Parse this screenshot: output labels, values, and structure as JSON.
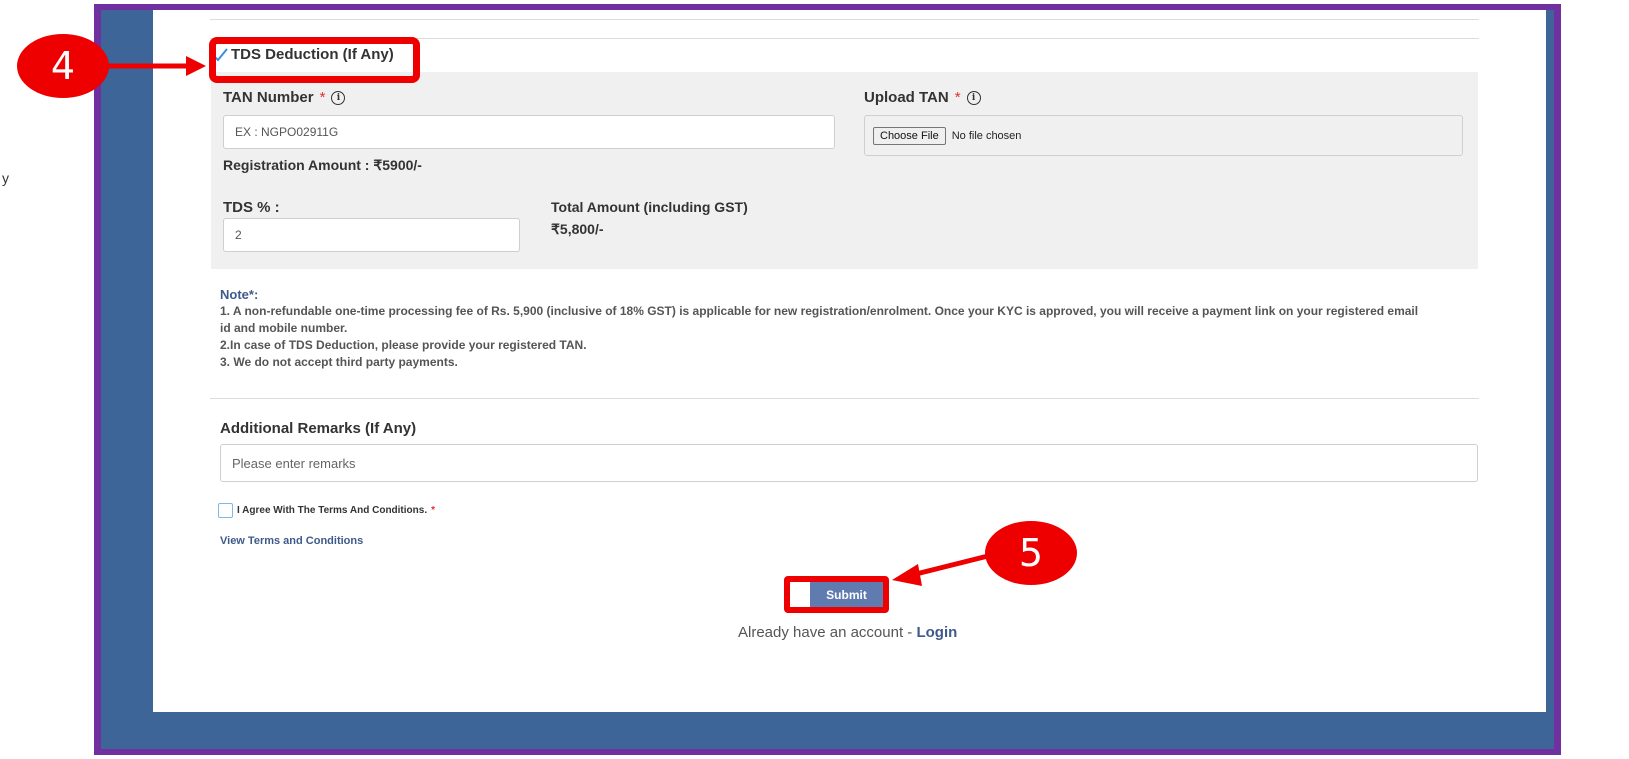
{
  "stray_char": "y",
  "tds": {
    "header": "TDS Deduction (If Any)",
    "tan_label": "TAN Number",
    "tan_placeholder": "EX : NGPO02911G",
    "upload_label": "Upload TAN",
    "choose_file": "Choose File",
    "no_file": "No file chosen",
    "registration_amount": "Registration Amount : ₹5900/-",
    "tds_percent_label": "TDS % :",
    "tds_percent_value": "2",
    "total_label": "Total Amount (including GST)",
    "total_value": "₹5,800/-",
    "required_mark": "*",
    "info_glyph": "i"
  },
  "note": {
    "title": "Note*:",
    "line1": "1. A non-refundable one-time processing fee of Rs. 5,900 (inclusive of 18% GST) is applicable for new registration/enrolment. Once your KYC is approved, you will receive a payment link on your registered email id and mobile number.",
    "line2": "2.In case of TDS Deduction, please provide your registered TAN.",
    "line3": "3. We do not accept third party payments."
  },
  "remarks": {
    "label": "Additional Remarks (If Any)",
    "placeholder": "Please enter remarks"
  },
  "agree_text": "I Agree With The Terms And Conditions.",
  "view_terms": "View Terms and Conditions",
  "submit": "Submit",
  "account_text": "Already have an account - ",
  "login": "Login",
  "callouts": {
    "step4": "4",
    "step5": "5"
  },
  "colors": {
    "frame": "#7030a0",
    "accent_blue": "#3d6598",
    "annotation_red": "#ee0000"
  },
  "icons": [
    "checkmark-icon",
    "info-icon",
    "arrow-icon"
  ]
}
